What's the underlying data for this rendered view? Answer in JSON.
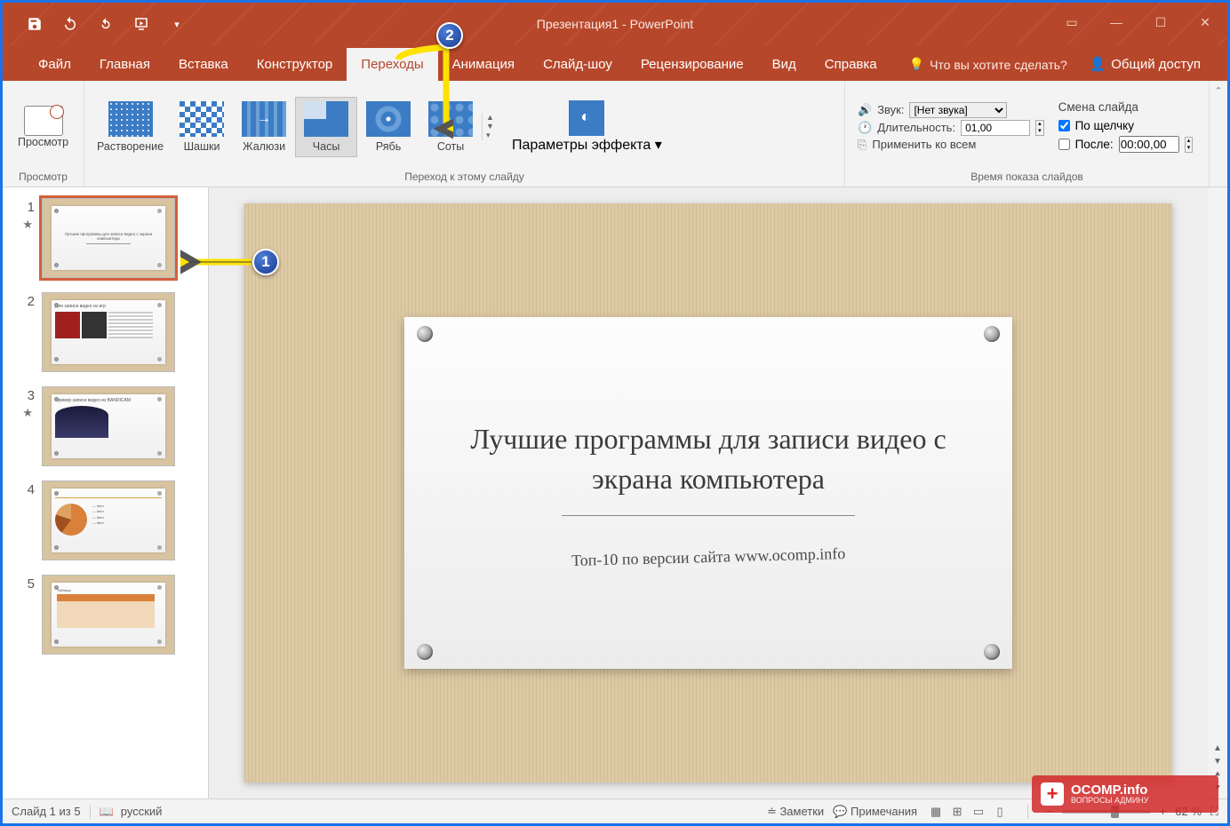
{
  "title": "Презентация1 - PowerPoint",
  "tabs": [
    "Файл",
    "Главная",
    "Вставка",
    "Конструктор",
    "Переходы",
    "Анимация",
    "Слайд-шоу",
    "Рецензирование",
    "Вид",
    "Справка"
  ],
  "active_tab_index": 4,
  "tell_me": "Что вы хотите сделать?",
  "share": "Общий доступ",
  "ribbon": {
    "preview_group": {
      "preview": "Просмотр",
      "label": "Просмотр"
    },
    "transitions_group": {
      "items": [
        "Растворение",
        "Шашки",
        "Жалюзи",
        "Часы",
        "Рябь",
        "Соты"
      ],
      "selected_index": 3,
      "label": "Переход к этому слайду",
      "effect_options": "Параметры эффекта"
    },
    "timing_group": {
      "sound_label": "Звук:",
      "sound_value": "[Нет звука]",
      "duration_label": "Длительность:",
      "duration_value": "01,00",
      "apply_all": "Применить ко всем",
      "advance_title": "Смена слайда",
      "on_click": "По щелчку",
      "after": "После:",
      "after_value": "00:00,00",
      "on_click_checked": true,
      "after_checked": false,
      "label": "Время показа слайдов"
    }
  },
  "thumbnails": [
    {
      "num": "1",
      "star": true,
      "title": "Лучшие программы для записи видео с экрана компьютера"
    },
    {
      "num": "2",
      "star": false,
      "title": "Для записи видео из игр"
    },
    {
      "num": "3",
      "star": true,
      "title": "Пример записи видео из BANDICAM"
    },
    {
      "num": "4",
      "star": false,
      "title": ""
    },
    {
      "num": "5",
      "star": false,
      "title": ""
    }
  ],
  "slide": {
    "title": "Лучшие программы для записи видео с экрана компьютера",
    "subtitle": "Топ-10 по версии сайта www.ocomp.info"
  },
  "statusbar": {
    "slide_of": "Слайд 1 из 5",
    "language": "русский",
    "notes": "Заметки",
    "comments": "Примечания",
    "zoom": "62 %"
  },
  "annotations": {
    "badge1": "1",
    "badge2": "2"
  },
  "watermark": {
    "main": "OCOMP.info",
    "sub": "ВОПРОСЫ АДМИНУ"
  }
}
